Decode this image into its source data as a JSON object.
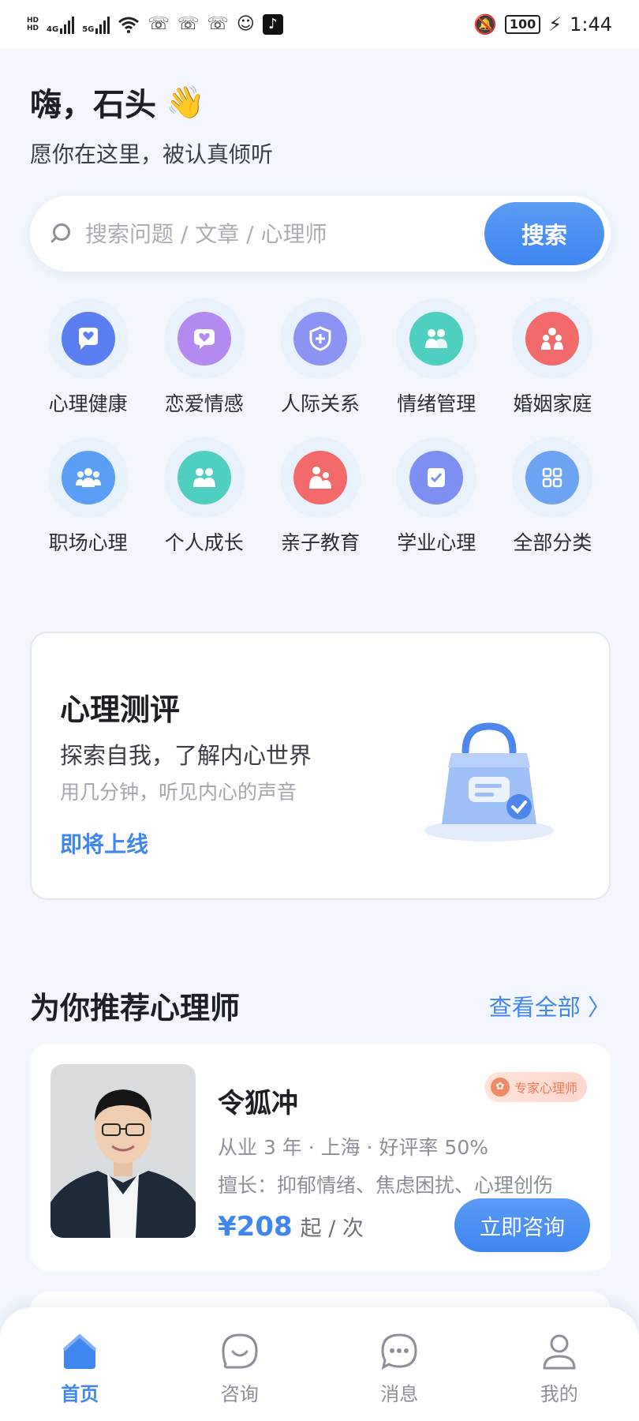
{
  "status_bar": {
    "hd1": "HD",
    "hd2": "HD",
    "net1": "4G",
    "net2": "5G",
    "battery": "100",
    "time": "1:44"
  },
  "greeting": {
    "title": "嗨，石头",
    "emoji": "👋",
    "subtitle": "愿你在这里，被认真倾听"
  },
  "search": {
    "placeholder": "搜索问题 / 文章 / 心理师",
    "button": "搜索"
  },
  "categories": [
    {
      "label": "心理健康",
      "icon": "chat-heart-icon",
      "color": "#5b7ff0"
    },
    {
      "label": "恋爱情感",
      "icon": "heart-message-icon",
      "color": "#b48af1"
    },
    {
      "label": "人际关系",
      "icon": "shield-plus-icon",
      "color": "#8b93f5"
    },
    {
      "label": "情绪管理",
      "icon": "two-people-icon",
      "color": "#4fcfc0"
    },
    {
      "label": "婚姻家庭",
      "icon": "family-icon",
      "color": "#f26a6a"
    },
    {
      "label": "职场心理",
      "icon": "group-icon",
      "color": "#5b9ef5"
    },
    {
      "label": "个人成长",
      "icon": "people-icon",
      "color": "#4fcfc0"
    },
    {
      "label": "亲子教育",
      "icon": "parent-child-icon",
      "color": "#f26a6a"
    },
    {
      "label": "学业心理",
      "icon": "checklist-icon",
      "color": "#7d8ff2"
    },
    {
      "label": "全部分类",
      "icon": "grid-icon",
      "color": "#6ea3f4"
    }
  ],
  "assessment": {
    "title": "心理测评",
    "subtitle": "探索自我，了解内心世界",
    "caption": "用几分钟，听见内心的声音",
    "link": "即将上线"
  },
  "recommend": {
    "title": "为你推荐心理师",
    "more": "查看全部 〉",
    "doctor": {
      "name": "令狐冲",
      "badge": "专家心理师",
      "meta": "从业 3 年 · 上海 · 好评率 50%",
      "skill": "擅长：抑郁情绪、焦虑困扰、心理创伤",
      "price": "¥208",
      "price_unit": "起 / 次",
      "button": "立即咨询"
    }
  },
  "tabbar": [
    {
      "label": "首页",
      "icon": "home-icon",
      "active": true
    },
    {
      "label": "咨询",
      "icon": "smile-chat-icon",
      "active": false
    },
    {
      "label": "消息",
      "icon": "message-icon",
      "active": false
    },
    {
      "label": "我的",
      "icon": "user-icon",
      "active": false
    }
  ],
  "colors": {
    "accent": "#3f86ef",
    "background": "#f3f7fd"
  }
}
